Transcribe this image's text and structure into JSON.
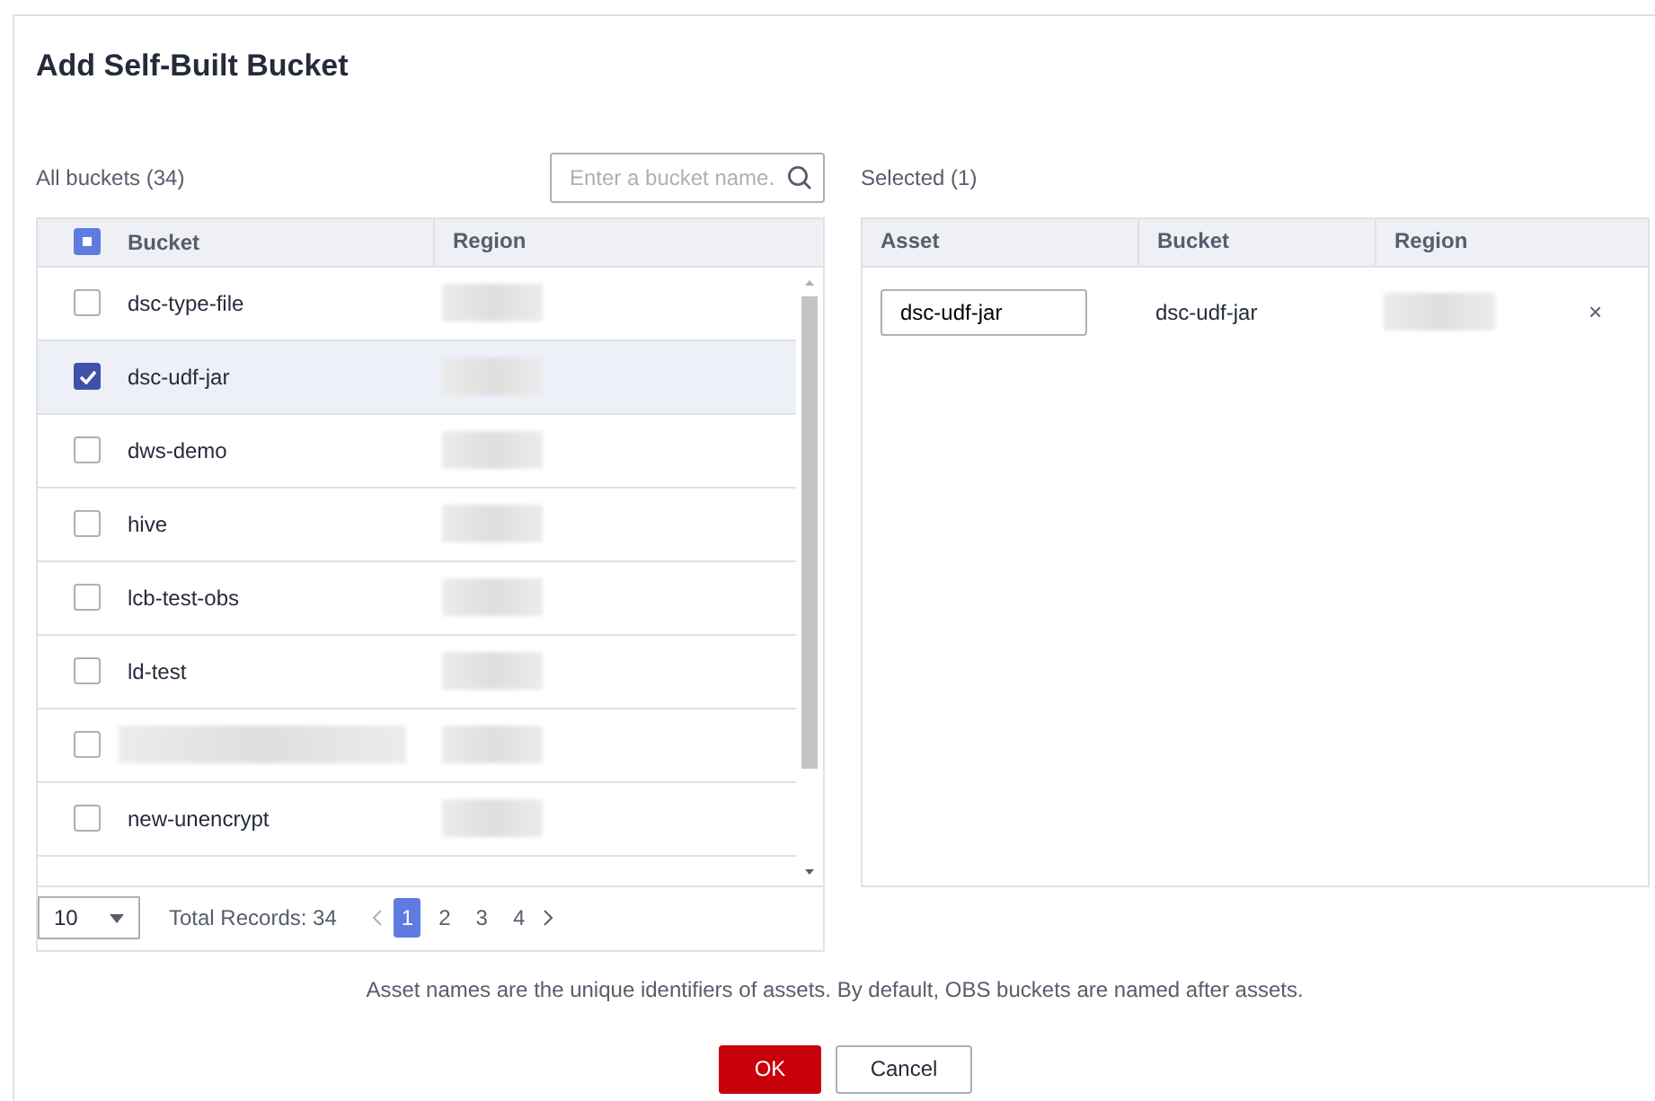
{
  "dialog": {
    "title": "Add Self-Built Bucket"
  },
  "all_buckets": {
    "label": "All buckets (34)",
    "search": {
      "placeholder": "Enter a bucket name."
    },
    "columns": [
      "Bucket",
      "Region"
    ],
    "header_checkbox": {
      "indeterminate": true
    },
    "rows": [
      {
        "kind": "text",
        "name": "dsc-type-file",
        "checked": false
      },
      {
        "kind": "text",
        "name": "dsc-udf-jar",
        "checked": true
      },
      {
        "kind": "text",
        "name": "dws-demo",
        "checked": false
      },
      {
        "kind": "text",
        "name": "hive",
        "checked": false
      },
      {
        "kind": "text",
        "name": "lcb-test-obs",
        "checked": false
      },
      {
        "kind": "text",
        "name": "ld-test",
        "checked": false
      },
      {
        "kind": "redacted",
        "checked": false
      },
      {
        "kind": "text",
        "name": "new-unencrypt",
        "checked": false
      }
    ],
    "pagination": {
      "page_size": "10",
      "total": "Total Records: 34",
      "pages": [
        {
          "label": "1",
          "selected": true
        },
        {
          "label": "2",
          "selected": false
        },
        {
          "label": "3",
          "selected": false
        },
        {
          "label": "4",
          "selected": false
        }
      ]
    }
  },
  "selected_buckets": {
    "label": "Selected (1)",
    "columns": [
      "Asset",
      "Bucket",
      "Region"
    ],
    "rows": [
      {
        "asset": "dsc-udf-jar",
        "bucket": "dsc-udf-jar",
        "remove": "×"
      }
    ]
  },
  "note": "Asset names are the unique identifiers of assets. By default, OBS buckets are named after assets.",
  "buttons": [
    {
      "label": "OK",
      "kind": "primary"
    },
    {
      "label": "Cancel",
      "kind": "secondary"
    }
  ]
}
